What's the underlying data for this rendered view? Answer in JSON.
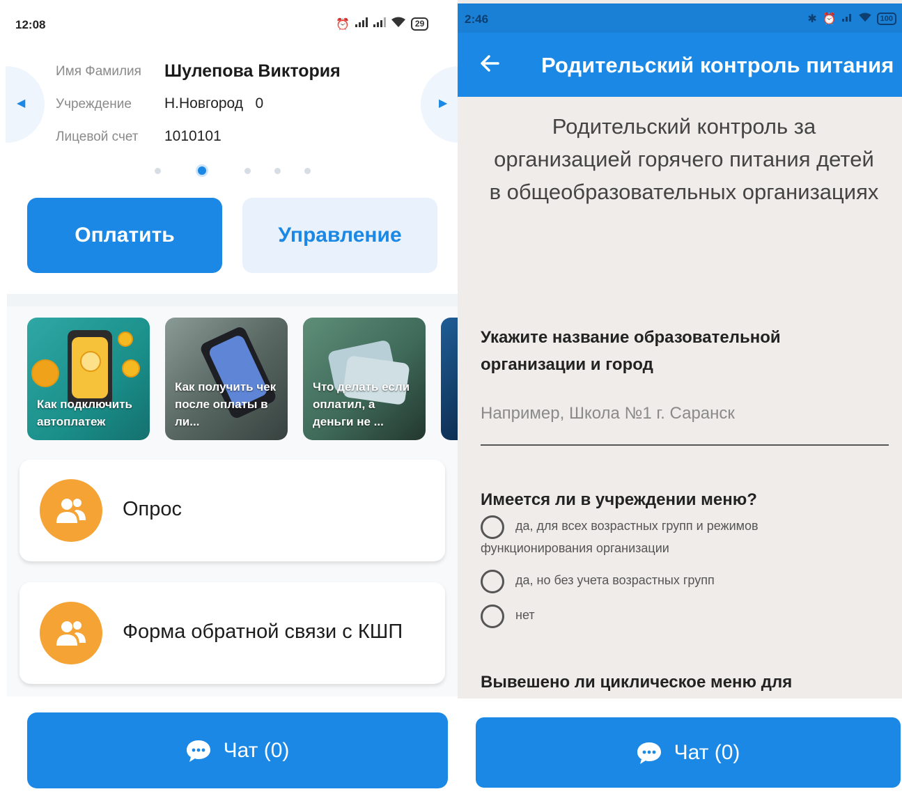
{
  "left": {
    "status": {
      "time": "12:08",
      "battery": "29"
    },
    "profile": {
      "name_label": "Имя Фамилия",
      "name_value": "Шулепова Виктория",
      "institution_label": "Учреждение",
      "institution_value": "Н.Новгород   0",
      "account_label": "Лицевой счет",
      "account_value": "1010101",
      "pager_total": 5,
      "pager_active": 2
    },
    "buttons": {
      "pay": "Оплатить",
      "manage": "Управление"
    },
    "stories": [
      {
        "caption": "Как подключить автоплатеж"
      },
      {
        "caption": "Как получить чек после оплаты в ли..."
      },
      {
        "caption": "Что делать если оплатил, а деньги не ..."
      }
    ],
    "cards": [
      {
        "title": "Опрос",
        "icon": "group-icon"
      },
      {
        "title": "Форма обратной связи с КШП",
        "icon": "group-icon"
      }
    ],
    "chat": {
      "label": "Чат (0)"
    }
  },
  "right": {
    "status": {
      "time": "2:46",
      "battery": "100"
    },
    "appbar": {
      "title": "Родительский контроль питания"
    },
    "heading": "Родительский контроль за организацией горячего питания детей в общеобразовательных организациях",
    "q1": {
      "text": "Укажите название образовательной организации и город",
      "placeholder": "Например, Школа №1 г. Саранск"
    },
    "q2": {
      "text": "Имеется ли в учреждении меню?",
      "options": [
        {
          "line1": "да, для всех возрастных групп и режимов",
          "line2": "функционирования организации"
        },
        {
          "line1": "да, но без учета возрастных групп"
        },
        {
          "line1": "нет"
        }
      ]
    },
    "q3": {
      "text": "Вывешено ли циклическое меню для"
    },
    "chat": {
      "label": "Чат (0)"
    }
  },
  "colors": {
    "primary": "#1a88e4",
    "accent_orange": "#f4a334",
    "form_bg": "#efece9"
  }
}
